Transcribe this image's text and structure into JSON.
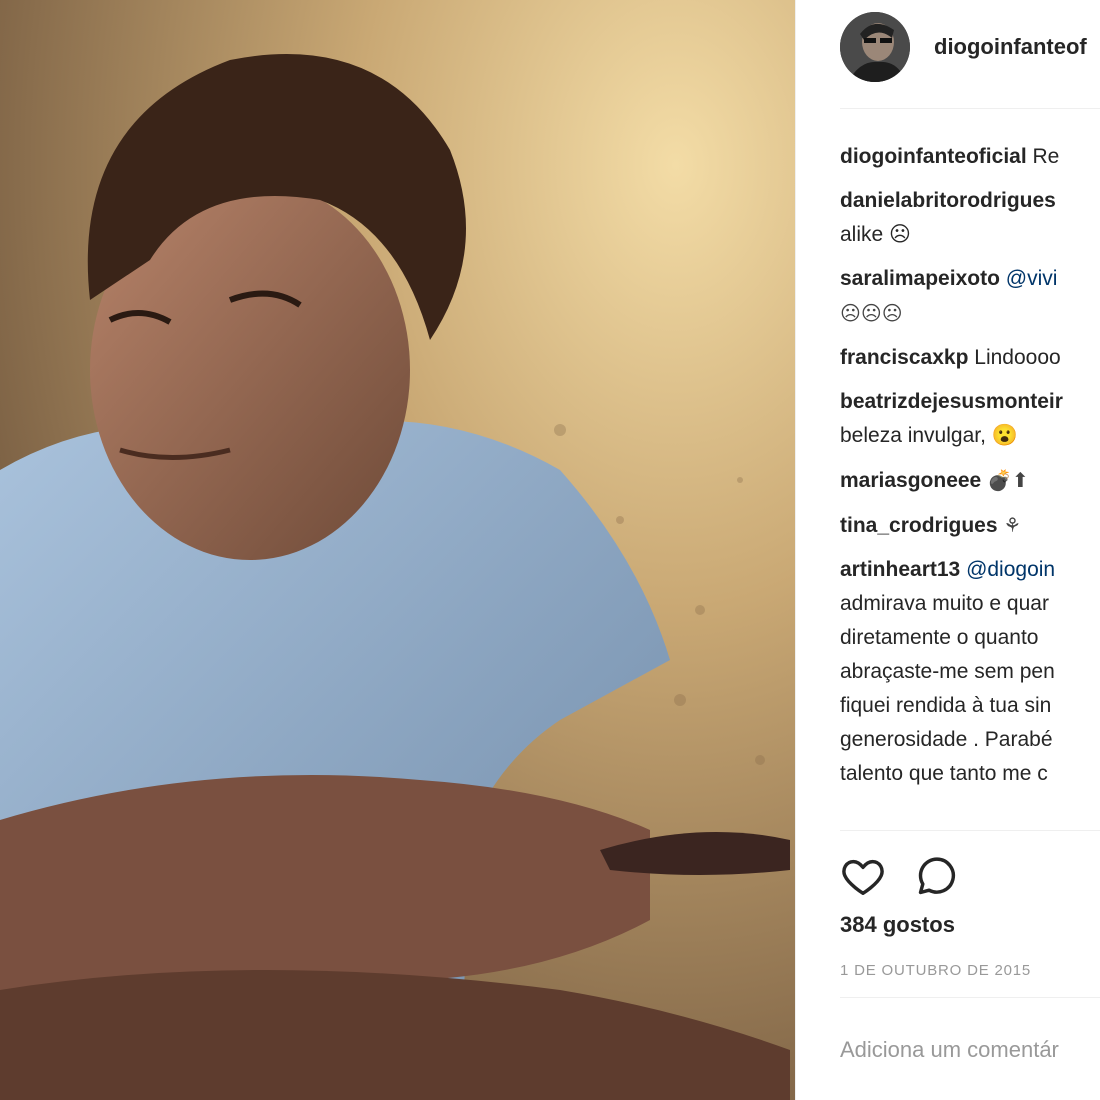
{
  "post": {
    "username": "diogoinfanteof",
    "caption": {
      "user": "diogoinfanteoficial",
      "text": "Re"
    },
    "comments": [
      {
        "user": "danielabritorodrigues",
        "text": "",
        "cont": "alike ☹"
      },
      {
        "user": "saralimapeixoto",
        "mention": "@vivi",
        "cont": "☹☹☹"
      },
      {
        "user": "franciscaxkp",
        "text": "Lindoooo"
      },
      {
        "user": "beatrizdejesusmonteir",
        "text": "",
        "cont": "beleza invulgar, 😮"
      },
      {
        "user": "mariasgoneee",
        "text": "💣⬆"
      },
      {
        "user": "tina_crodrigues",
        "text": "⚘"
      },
      {
        "user": "artinheart13",
        "mention": "@diogoin",
        "cont_lines": [
          "admirava muito e quar",
          "diretamente o quanto",
          "abraçaste-me sem pen",
          "fiquei rendida à tua sin",
          "generosidade . Parabé",
          "talento que tanto me c"
        ]
      }
    ],
    "likes": "384 gostos",
    "date": "1 DE OUTUBRO DE 2015",
    "comment_placeholder": "Adiciona um comentár",
    "icons": {
      "like": "heart-icon",
      "comment": "comment-icon"
    }
  }
}
